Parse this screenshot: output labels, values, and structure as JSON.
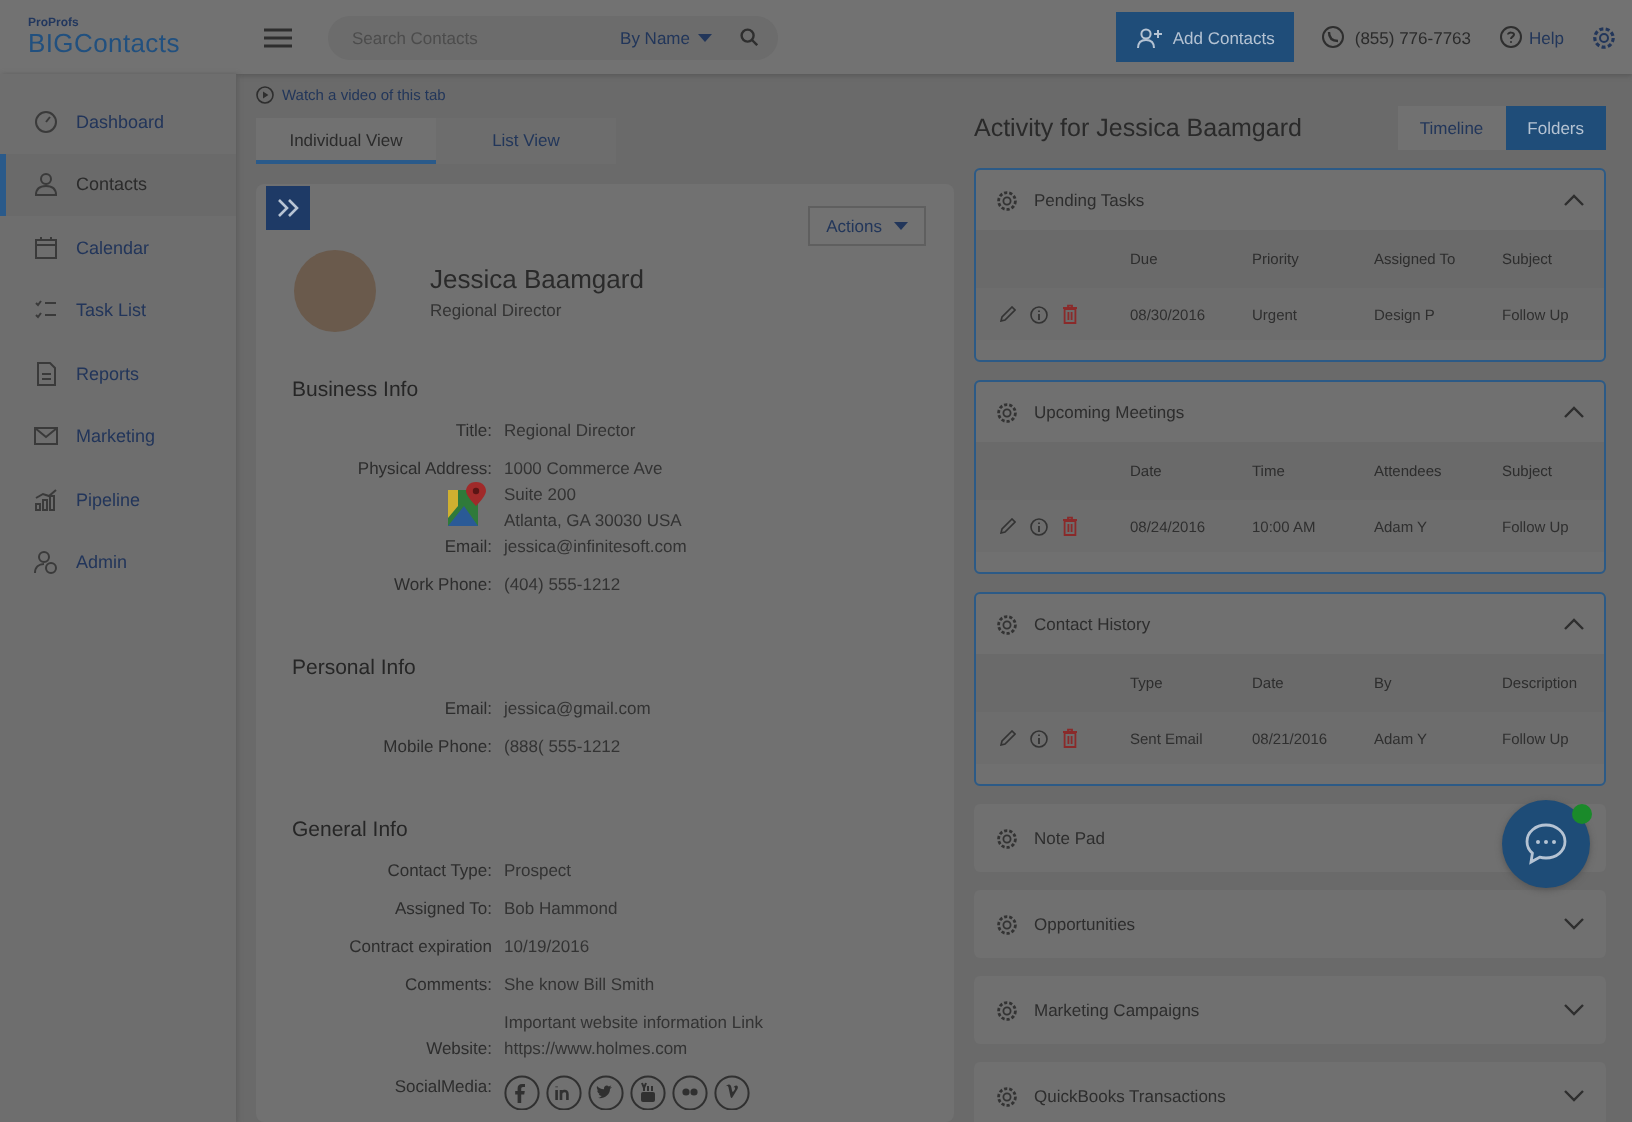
{
  "header": {
    "brand_small": "ProProfs",
    "brand": "BIGContacts",
    "search": {
      "placeholder": "Search Contacts",
      "filter": "By Name"
    },
    "add_button": "Add Contacts",
    "phone": "(855) 776-7763",
    "help": "Help"
  },
  "sidebar": {
    "items": [
      {
        "label": "Dashboard",
        "kind": "gauge",
        "selected": false
      },
      {
        "label": "Contacts",
        "kind": "person",
        "selected": true
      },
      {
        "label": "Calendar",
        "kind": "calendar",
        "selected": false
      },
      {
        "label": "Task List",
        "kind": "checklist",
        "selected": false
      },
      {
        "label": "Reports",
        "kind": "document",
        "selected": false
      },
      {
        "label": "Marketing",
        "kind": "envelope",
        "selected": false
      },
      {
        "label": "Pipeline",
        "kind": "bars",
        "selected": false
      },
      {
        "label": "Admin",
        "kind": "admin",
        "selected": false
      }
    ]
  },
  "video_link": "Watch a video of this tab",
  "view_tabs": [
    {
      "label": "Individual View",
      "selected": true
    },
    {
      "label": "List View",
      "selected": false
    }
  ],
  "contact": {
    "actions": "Actions",
    "name": "Jessica Baamgard",
    "title": "Regional Director",
    "sections": [
      {
        "title": "Business Info",
        "fields": [
          {
            "kind": "text",
            "label": "Title:",
            "lines": [
              "Regional Director"
            ]
          },
          {
            "kind": "address",
            "label": "Physical Address:",
            "lines": [
              "1000 Commerce Ave",
              "Suite 200",
              "Atlanta, GA 30030 USA"
            ]
          },
          {
            "kind": "text",
            "label": "Email:",
            "lines": [
              "jessica@infinitesoft.com"
            ]
          },
          {
            "kind": "text",
            "label": "Work Phone:",
            "lines": [
              "(404) 555-1212"
            ]
          }
        ]
      },
      {
        "title": "Personal Info",
        "fields": [
          {
            "kind": "text",
            "label": "Email:",
            "lines": [
              "jessica@gmail.com"
            ]
          },
          {
            "kind": "text",
            "label": "Mobile Phone:",
            "lines": [
              "(888( 555-1212"
            ]
          }
        ]
      },
      {
        "title": "General Info",
        "fields": [
          {
            "kind": "text",
            "label": "Contact Type:",
            "lines": [
              "Prospect"
            ]
          },
          {
            "kind": "text",
            "label": "Assigned To:",
            "lines": [
              "Bob Hammond"
            ]
          },
          {
            "kind": "text",
            "label": "Contract expiration",
            "lines": [
              "10/19/2016"
            ]
          },
          {
            "kind": "text",
            "label": "Comments:",
            "lines": [
              "She know Bill Smith",
              "Important website information Link"
            ]
          },
          {
            "kind": "text",
            "label": "Website:",
            "lines": [
              "https://www.holmes.com"
            ]
          },
          {
            "kind": "social",
            "label": "SocialMedia:"
          }
        ]
      }
    ]
  },
  "activity": {
    "title": "Activity for Jessica Baamgard",
    "view_toggle": [
      {
        "label": "Timeline",
        "selected": false
      },
      {
        "label": "Folders",
        "selected": true
      }
    ],
    "panels": [
      {
        "title": "Pending Tasks",
        "expanded": true,
        "columns": [
          "Due",
          "Priority",
          "Assigned To",
          "Subject"
        ],
        "rows": [
          [
            "08/30/2016",
            "Urgent",
            "Design P",
            "Follow Up"
          ]
        ]
      },
      {
        "title": "Upcoming Meetings",
        "expanded": true,
        "columns": [
          "Date",
          "Time",
          "Attendees",
          "Subject"
        ],
        "rows": [
          [
            "08/24/2016",
            "10:00 AM",
            "Adam Y",
            "Follow Up"
          ]
        ]
      },
      {
        "title": "Contact History",
        "expanded": true,
        "columns": [
          "Type",
          "Date",
          "By",
          "Description"
        ],
        "rows": [
          [
            "Sent Email",
            "08/21/2016",
            "Adam Y",
            "Follow Up"
          ]
        ]
      },
      {
        "title": "Note Pad",
        "expanded": false
      },
      {
        "title": "Opportunities",
        "expanded": false
      },
      {
        "title": "Marketing Campaigns",
        "expanded": false
      },
      {
        "title": "QuickBooks Transactions",
        "expanded": false
      }
    ]
  },
  "chat": {
    "online": true
  }
}
